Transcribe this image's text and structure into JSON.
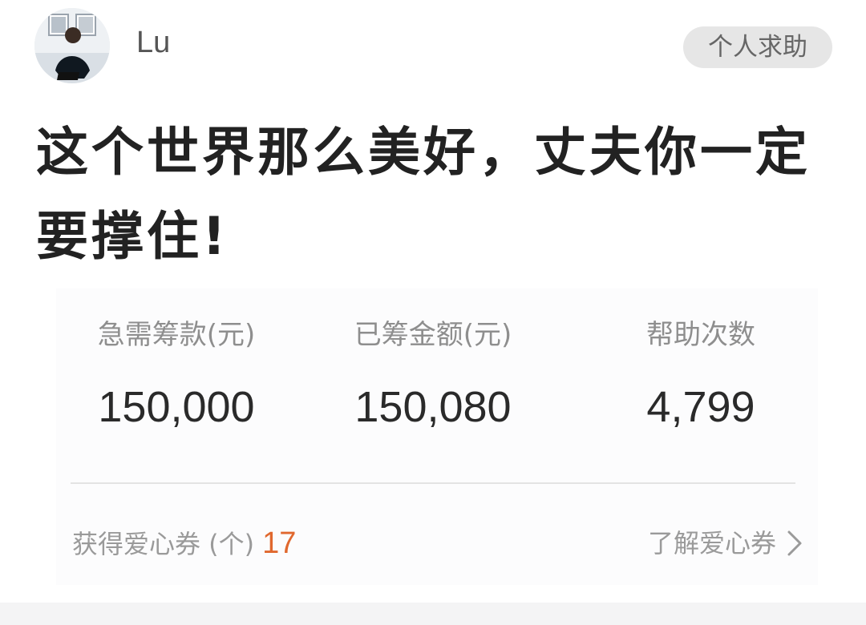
{
  "author": {
    "name": "Lu",
    "avatar_icon": "user-avatar-icon"
  },
  "category": {
    "label": "个人求助"
  },
  "campaign": {
    "title": "这个世界那么美好，丈夫你一定要撑住!"
  },
  "stats": [
    {
      "label": "急需筹款(元)",
      "value": "150,000"
    },
    {
      "label": "已筹金额(元)",
      "value": "150,080"
    },
    {
      "label": "帮助次数",
      "value": "4,799"
    }
  ],
  "coupons": {
    "label": "获得爱心券 (个)",
    "count": "17",
    "link_label": "了解爱心券",
    "link_icon": "chevron-right-icon",
    "count_color": "#e0682e"
  }
}
